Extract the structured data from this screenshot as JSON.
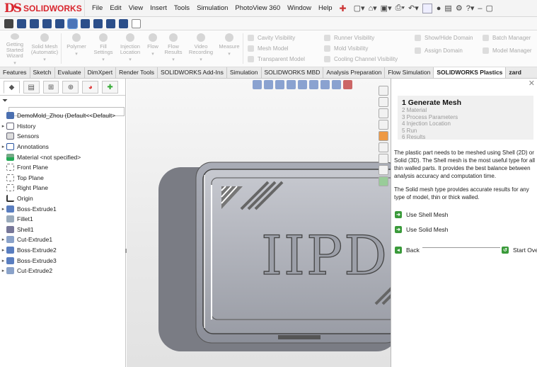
{
  "app": {
    "logo_ds": "DS",
    "logo_name": "SOLIDWORKS"
  },
  "menu": [
    "File",
    "Edit",
    "View",
    "Insert",
    "Tools",
    "Simulation",
    "PhotoView 360",
    "Window",
    "Help"
  ],
  "ribbon": {
    "buttons": [
      {
        "label": "Getting Started Wizard"
      },
      {
        "label": "Solid Mesh (Automatic)"
      },
      {
        "label": "Polymer"
      },
      {
        "label": "Fill Settings"
      },
      {
        "label": "Injection Location"
      },
      {
        "label": "Flow"
      },
      {
        "label": "Flow Results"
      },
      {
        "label": "Video Recording"
      },
      {
        "label": "Measure"
      }
    ],
    "col1": [
      "Cavity Visibility",
      "Mesh Model",
      "Transparent Model"
    ],
    "col2": [
      "Runner Visibility",
      "Mold Visibility",
      "Cooling Channel Visibility"
    ],
    "col3": [
      "Show/Hide Domain",
      "Assign Domain"
    ],
    "col4": [
      "Batch Manager",
      "Model Manager"
    ]
  },
  "tabs": [
    "Features",
    "Sketch",
    "Evaluate",
    "DimXpert",
    "Render Tools",
    "SOLIDWORKS Add-Ins",
    "Simulation",
    "SOLIDWORKS MBD",
    "Analysis Preparation",
    "Flow Simulation",
    "SOLIDWORKS Plastics",
    "zard"
  ],
  "active_tab": "SOLIDWORKS Plastics",
  "tree": [
    {
      "label": "DemoMold_Zhou  (Default<<Default>",
      "icon": "part-icon",
      "expand": ""
    },
    {
      "label": "History",
      "icon": "history-icon",
      "expand": "▸"
    },
    {
      "label": "Sensors",
      "icon": "sensors-icon",
      "expand": ""
    },
    {
      "label": "Annotations",
      "icon": "annotations-icon",
      "expand": "▸"
    },
    {
      "label": "Material <not specified>",
      "icon": "material-icon",
      "expand": ""
    },
    {
      "label": "Front Plane",
      "icon": "plane-icon",
      "expand": ""
    },
    {
      "label": "Top Plane",
      "icon": "plane-icon",
      "expand": ""
    },
    {
      "label": "Right Plane",
      "icon": "plane-icon",
      "expand": ""
    },
    {
      "label": "Origin",
      "icon": "origin-icon",
      "expand": ""
    },
    {
      "label": "Boss-Extrude1",
      "icon": "feature-icon",
      "expand": "▸"
    },
    {
      "label": "Fillet1",
      "icon": "fillet-icon",
      "expand": ""
    },
    {
      "label": "Shell1",
      "icon": "shell-icon",
      "expand": ""
    },
    {
      "label": "Cut-Extrude1",
      "icon": "cut-icon",
      "expand": "▸"
    },
    {
      "label": "Boss-Extrude2",
      "icon": "feature-icon",
      "expand": "▸"
    },
    {
      "label": "Boss-Extrude3",
      "icon": "feature-icon",
      "expand": "▸"
    },
    {
      "label": "Cut-Extrude2",
      "icon": "cut-icon",
      "expand": "▸"
    }
  ],
  "model_text": "IIPD",
  "wizard": {
    "current_step": "1 Generate Mesh",
    "steps": [
      "2 Material",
      "3 Process Parameters",
      "4 Injection Location",
      "5 Run",
      "6 Results"
    ],
    "para1": [
      "The plastic part needs to be meshed using Shell (2D) or",
      "Solid (3D). The Shell mesh is the most useful type for all",
      "thin walled parts. It provides the best balance between",
      "analysis accuracy and computation time."
    ],
    "para2": [
      "The Solid mesh type provides accurate results for any",
      "type of model, thin or thick walled."
    ],
    "use_shell": "Use Shell Mesh",
    "use_solid": "Use Solid Mesh",
    "back": "Back",
    "start_over": "Start Over"
  }
}
